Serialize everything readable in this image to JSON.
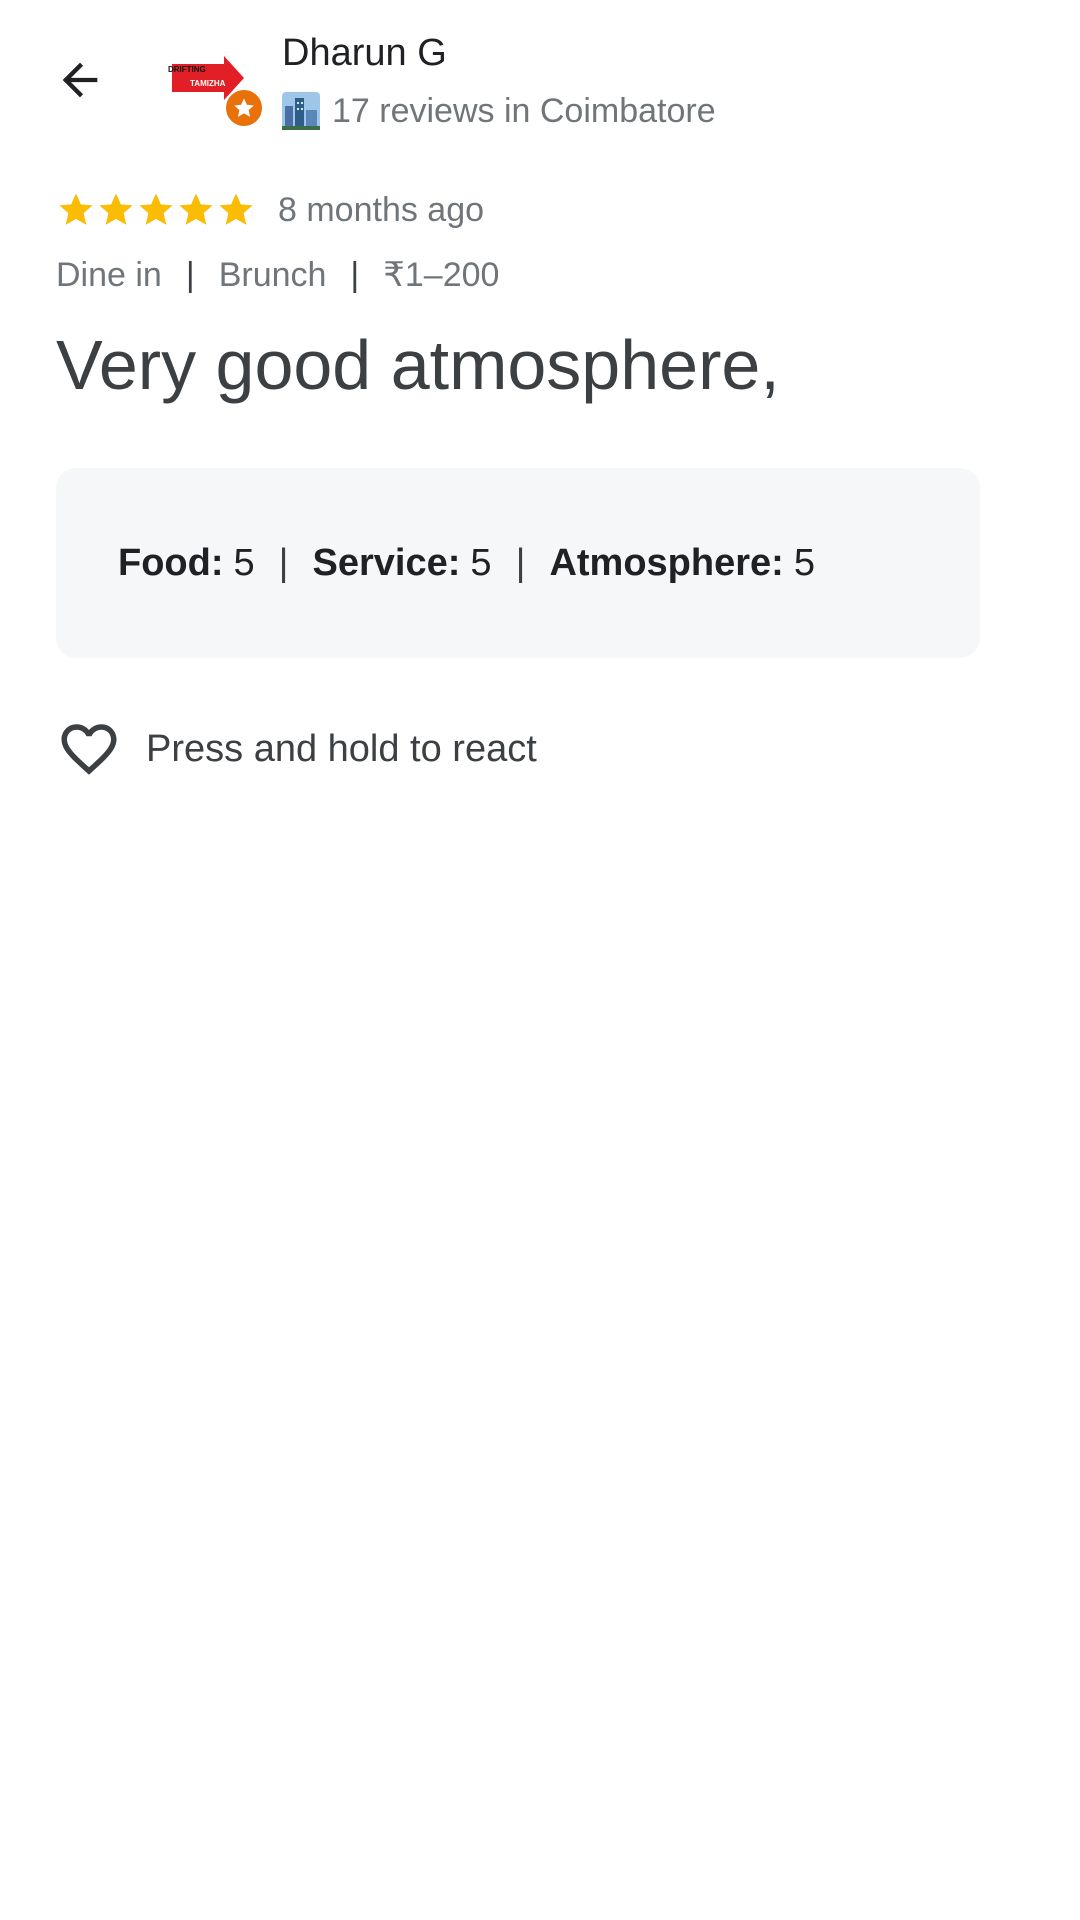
{
  "header": {
    "back_icon": "arrow-left-icon",
    "avatar_text_top": "DRIFTING",
    "avatar_text_bottom": "TAMIZHA",
    "author_name": "Dharun G",
    "local_guide_icon": "city-icon",
    "reviews_summary": "17 reviews in Coimbatore",
    "badge_icon": "star-icon",
    "badge_color": "#e8710a"
  },
  "review": {
    "stars": 5,
    "star_color": "#fbbc04",
    "time_ago": "8 months ago",
    "meta": {
      "service_type": "Dine in",
      "meal_type": "Brunch",
      "price": "₹1–200",
      "separator": "|"
    },
    "text": "Very good atmosphere,"
  },
  "ratings": {
    "separator": "|",
    "items": [
      {
        "label": "Food:",
        "value": "5"
      },
      {
        "label": "Service:",
        "value": "5"
      },
      {
        "label": "Atmosphere:",
        "value": "5"
      }
    ]
  },
  "react": {
    "icon": "heart-outline-icon",
    "label": "Press and hold to react"
  }
}
